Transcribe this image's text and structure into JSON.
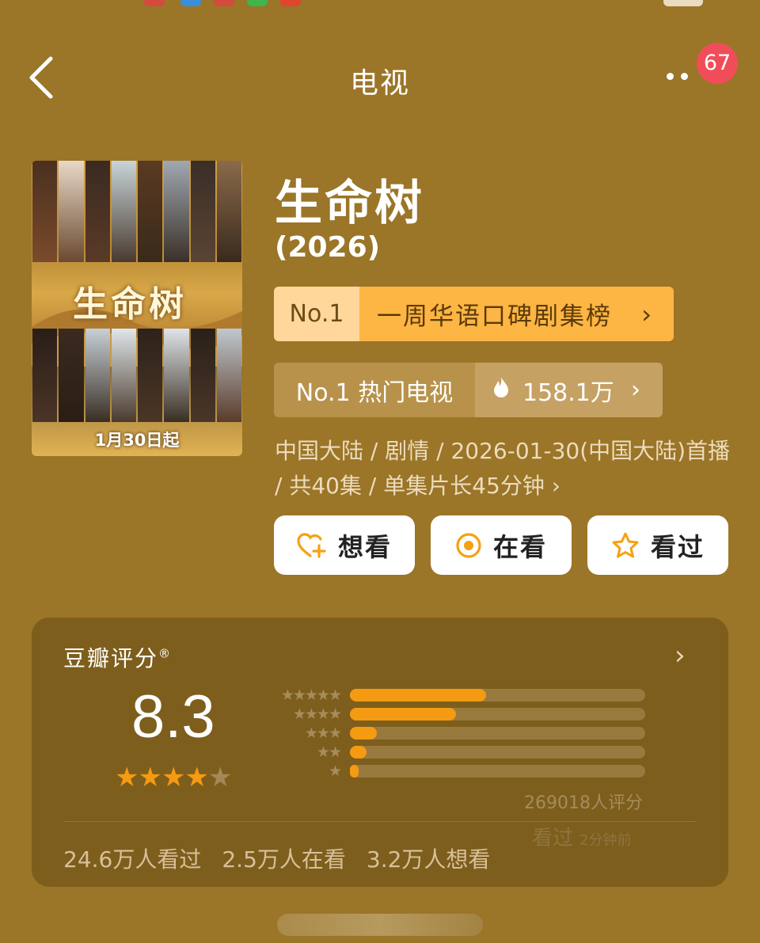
{
  "nav": {
    "title": "电视",
    "badge_count": "67"
  },
  "poster": {
    "title_art": "生命树",
    "date": "1月30日起"
  },
  "show": {
    "title": "生命树",
    "year": "(2026)"
  },
  "rank_primary": {
    "rank": "No.1",
    "label": "一周华语口碑剧集榜",
    "chevron": "›"
  },
  "rank_secondary": {
    "label": "No.1 热门电视",
    "hot_value": "158.1万",
    "chevron": "›"
  },
  "meta": {
    "text": "中国大陆 / 剧情 / 2026-01-30(中国大陆)首播 / 共40集 / 单集片长45分钟 ›"
  },
  "actions": {
    "want": "想看",
    "watching": "在看",
    "watched": "看过"
  },
  "rating": {
    "title": "豆瓣评分",
    "registered": "®",
    "chevron": "›",
    "score": "8.3",
    "stars_value": 4.15,
    "distribution": [
      {
        "stars": "★★★★★",
        "share": 0.46
      },
      {
        "stars": "★★★★",
        "share": 0.36
      },
      {
        "stars": "★★★",
        "share": 0.09
      },
      {
        "stars": "★★",
        "share": 0.055
      },
      {
        "stars": "★",
        "share": 0.03
      }
    ],
    "count": "269018人评分",
    "ghost_watched": "看过",
    "ghost_time": "2分钟前"
  },
  "stats": {
    "watched": "24.6万人看过",
    "watching": "2.5万人在看",
    "want": "3.2万人想看"
  },
  "colors": {
    "background": "#9b7528",
    "accent_orange": "#f59a13",
    "rank_gold": "#fdb544",
    "badge_red": "#f14d59"
  },
  "icons": {
    "back": "back-arrow-icon",
    "more": "more-dots-icon",
    "flame": "flame-icon",
    "want": "heart-plus-icon",
    "watching": "target-icon",
    "watched": "star-outline-icon"
  }
}
